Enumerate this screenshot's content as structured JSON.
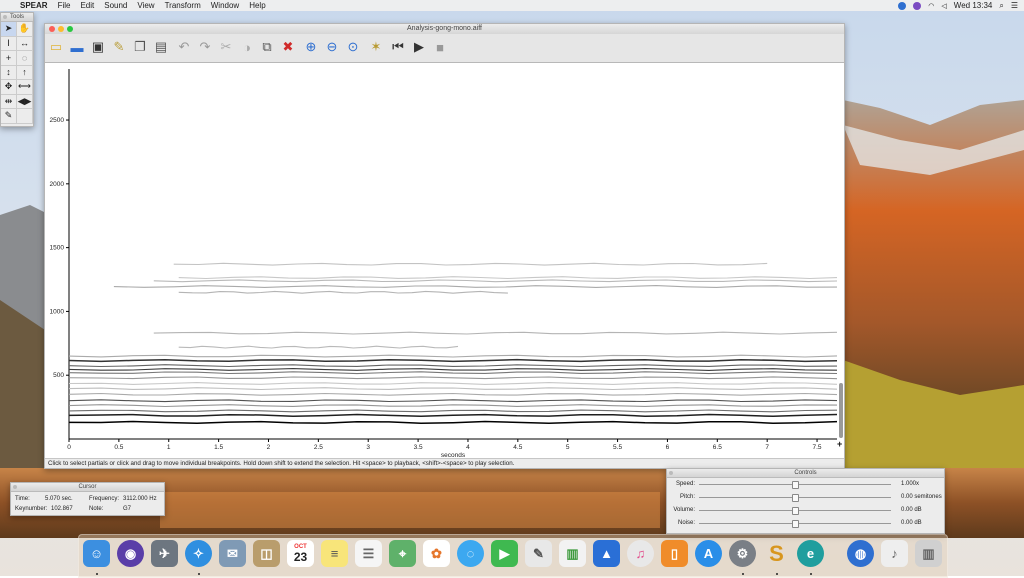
{
  "menubar": {
    "apple": "",
    "items": [
      "SPEAR",
      "File",
      "Edit",
      "Sound",
      "View",
      "Transform",
      "Window",
      "Help"
    ],
    "clock": "Wed 13:34"
  },
  "tools_panel": {
    "title": "Tools"
  },
  "window": {
    "title": "Analysis-gong-mono.aiff",
    "status": "Click to select partials or click and drag to move individual breakpoints. Hold down shift to extend the selection. Hit <space> to playback, <shift>-<space> to play selection."
  },
  "plot": {
    "xlabel": "seconds",
    "xticks": [
      "0",
      "0.5",
      "1",
      "1.5",
      "2",
      "2.5",
      "3",
      "3.5",
      "4",
      "4.5",
      "5",
      "5.5",
      "6",
      "6.5",
      "7",
      "7.5"
    ],
    "x_values": [
      0,
      0.5,
      1,
      1.5,
      2,
      2.5,
      3,
      3.5,
      4,
      4.5,
      5,
      5.5,
      6,
      6.5,
      7,
      7.5
    ],
    "yticks": [
      "500",
      "1000",
      "1500",
      "2000",
      "2500"
    ],
    "y_values": [
      500,
      1000,
      1500,
      2000,
      2500
    ],
    "xlim": [
      0,
      7.7
    ],
    "ylim": [
      0,
      2900
    ],
    "partials": [
      {
        "f": 130,
        "t0": 0,
        "t1": 7.7,
        "g": 0
      },
      {
        "f": 185,
        "t0": 0,
        "t1": 7.7,
        "g": 30
      },
      {
        "f": 220,
        "t0": 0,
        "t1": 7.7,
        "g": 110
      },
      {
        "f": 262,
        "t0": 0,
        "t1": 7.7,
        "g": 150
      },
      {
        "f": 300,
        "t0": 0,
        "t1": 7.7,
        "g": 80
      },
      {
        "f": 350,
        "t0": 0,
        "t1": 7.7,
        "g": 170
      },
      {
        "f": 395,
        "t0": 0,
        "t1": 7.7,
        "g": 190
      },
      {
        "f": 435,
        "t0": 0,
        "t1": 7.7,
        "g": 200
      },
      {
        "f": 480,
        "t0": 0,
        "t1": 7.7,
        "g": 150
      },
      {
        "f": 520,
        "t0": 0,
        "t1": 7.7,
        "g": 120
      },
      {
        "f": 545,
        "t0": 0,
        "t1": 7.7,
        "g": 60
      },
      {
        "f": 575,
        "t0": 0,
        "t1": 7.7,
        "g": 100
      },
      {
        "f": 615,
        "t0": 0,
        "t1": 7.7,
        "g": 50
      },
      {
        "f": 650,
        "t0": 0,
        "t1": 7.7,
        "g": 170
      },
      {
        "f": 720,
        "t0": 1.1,
        "t1": 3.9,
        "g": 185
      },
      {
        "f": 830,
        "t0": 0.85,
        "t1": 7.7,
        "g": 180
      },
      {
        "f": 1150,
        "t0": 1.1,
        "t1": 4.4,
        "g": 180
      },
      {
        "f": 1195,
        "t0": 0.45,
        "t1": 7.7,
        "g": 170
      },
      {
        "f": 1240,
        "t0": 0.85,
        "t1": 7.7,
        "g": 185
      },
      {
        "f": 1265,
        "t0": 1.1,
        "t1": 7.7,
        "g": 200
      },
      {
        "f": 1370,
        "t0": 1.05,
        "t1": 7.0,
        "g": 195
      }
    ]
  },
  "cursor_panel": {
    "title": "Cursor",
    "time_label": "Time:",
    "time_value": "5.070 sec.",
    "freq_label": "Frequency:",
    "freq_value": "3112.000 Hz",
    "key_label": "Keynumber:",
    "key_value": "102.867",
    "note_label": "Note:",
    "note_value": "G7"
  },
  "controls_panel": {
    "title": "Controls",
    "rows": [
      {
        "label": "Speed:",
        "value": "1.000x",
        "level": 0.5
      },
      {
        "label": "Pitch:",
        "value": "0.00 semitones",
        "level": 0.5
      },
      {
        "label": "Volume:",
        "value": "0.00 dB",
        "level": 0.5
      },
      {
        "label": "Noise:",
        "value": "0.00 dB",
        "level": 0.5
      }
    ]
  },
  "dock": {
    "calendar_month": "OCT",
    "calendar_day": "23"
  },
  "colors": {
    "accent": "#2a6fd6",
    "close": "#fc5f57",
    "minimize": "#fdbc2e",
    "zoom": "#28c840"
  }
}
